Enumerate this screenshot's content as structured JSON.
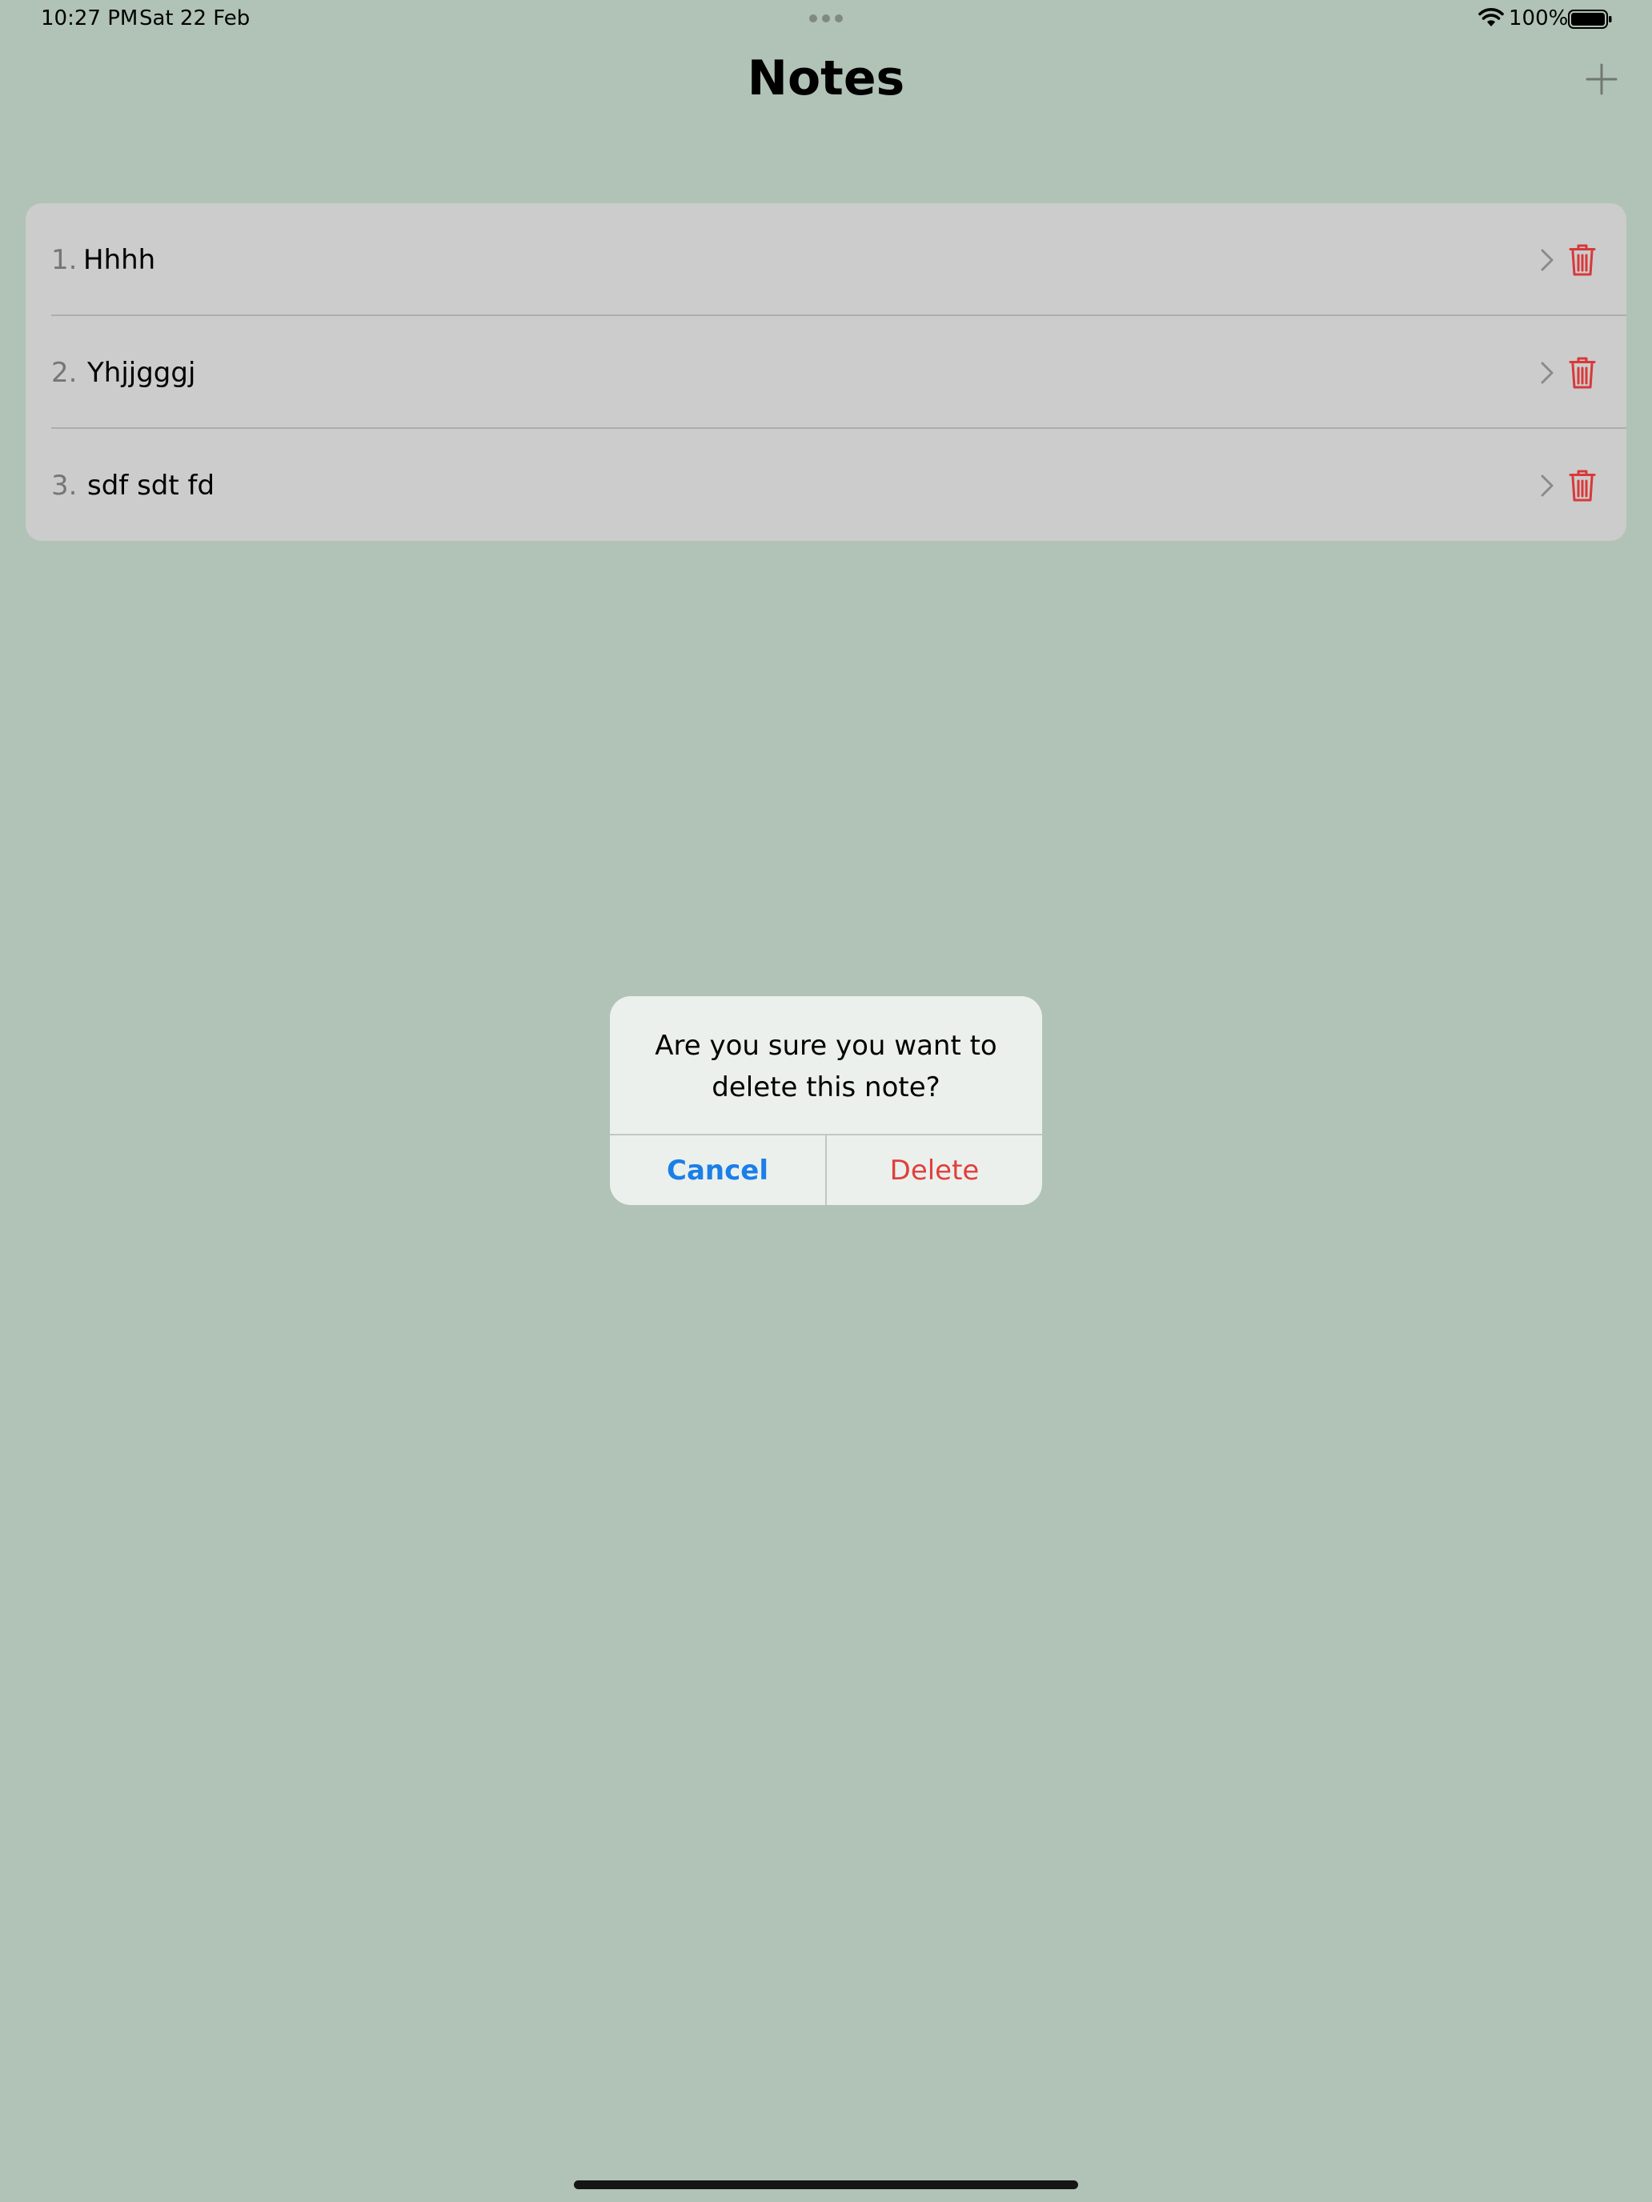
{
  "status_bar": {
    "time": "10:27 PM",
    "date": "Sat 22 Feb",
    "battery": "100%"
  },
  "header": {
    "title": "Notes"
  },
  "notes": [
    {
      "index": "1.",
      "title": "Hhhh"
    },
    {
      "index": "2.",
      "title": "Yhjjgggj"
    },
    {
      "index": "3.",
      "title": "sdf sdt fd"
    }
  ],
  "alert": {
    "message": "Are you sure you want to delete this note?",
    "cancel_label": "Cancel",
    "delete_label": "Delete"
  },
  "colors": {
    "background": "#b0c3b6",
    "list_background": "#cccccc",
    "alert_background": "#ebf0ed",
    "cancel": "#1a7fe8",
    "delete": "#e0403b",
    "trash_icon": "#d9383a"
  },
  "icons": {
    "add": "plus-icon",
    "row_disclosure": "chevron-right-icon",
    "row_delete": "trash-icon",
    "wifi": "wifi-icon",
    "battery": "battery-full-icon"
  }
}
